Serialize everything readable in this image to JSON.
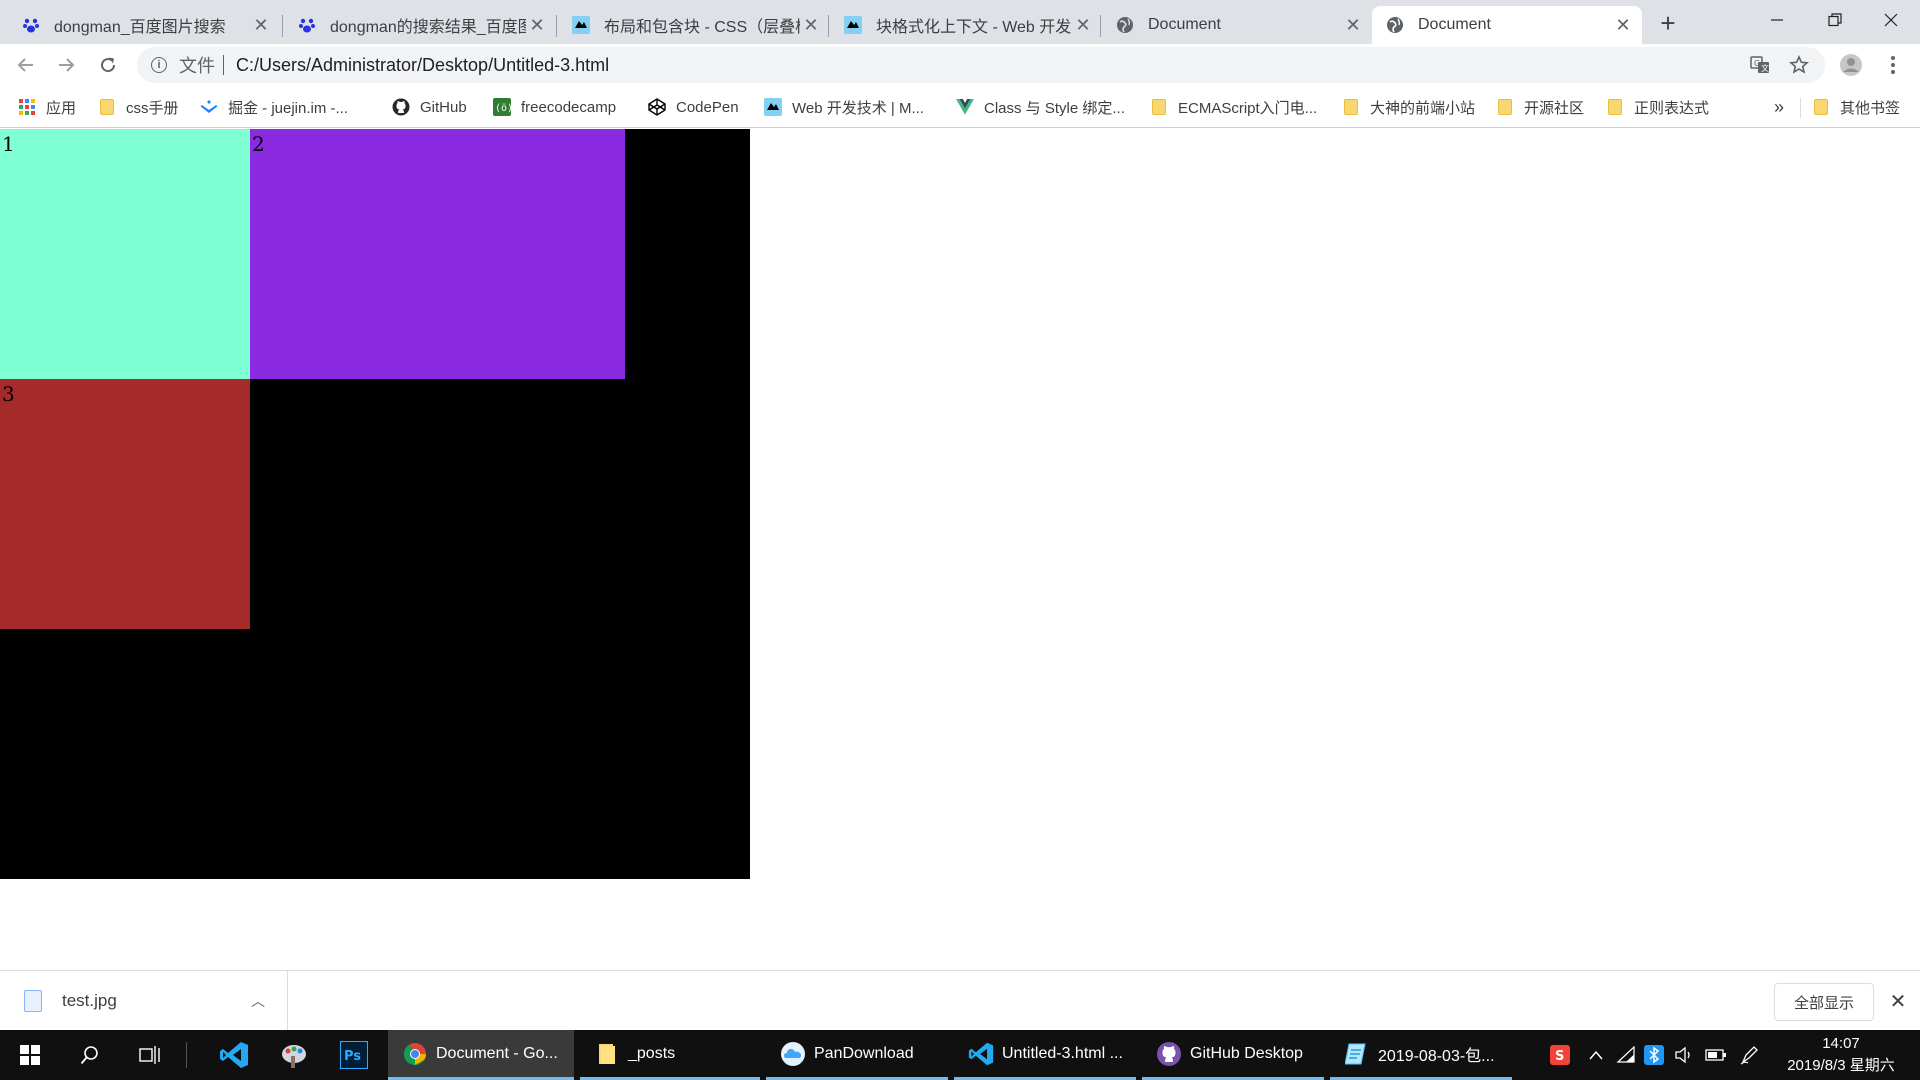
{
  "browser": {
    "tabs": [
      {
        "title": "dongman_百度图片搜索",
        "icon": "baidu-paw-icon"
      },
      {
        "title": "dongman的搜索结果_百度图",
        "icon": "baidu-paw-icon"
      },
      {
        "title": "布局和包含块 - CSS（层叠样",
        "icon": "mdn-icon"
      },
      {
        "title": "块格式化上下文 - Web 开发",
        "icon": "mdn-icon"
      },
      {
        "title": "Document",
        "icon": "globe-icon"
      },
      {
        "title": "Document",
        "icon": "globe-icon",
        "active": true
      }
    ],
    "url_scheme_label": "文件",
    "url": "C:/Users/Administrator/Desktop/Untitled-3.html"
  },
  "bookmarks": [
    {
      "label": "应用",
      "icon": "apps-grid-icon"
    },
    {
      "label": "css手册",
      "icon": "folder-icon"
    },
    {
      "label": "掘金 - juejin.im -...",
      "icon": "juejin-icon"
    },
    {
      "label": "GitHub",
      "icon": "github-icon"
    },
    {
      "label": "freecodecamp",
      "icon": "freecodecamp-icon"
    },
    {
      "label": "CodePen",
      "icon": "codepen-icon"
    },
    {
      "label": "Web 开发技术 | M...",
      "icon": "mdn-icon"
    },
    {
      "label": "Class 与 Style 绑定...",
      "icon": "vue-icon"
    },
    {
      "label": "ECMAScript入门电...",
      "icon": "folder-icon"
    },
    {
      "label": "大神的前端小站",
      "icon": "folder-icon"
    },
    {
      "label": "开源社区",
      "icon": "folder-icon"
    },
    {
      "label": "正则表达式",
      "icon": "folder-icon"
    },
    {
      "label": "其他书签",
      "icon": "folder-icon"
    }
  ],
  "bookmarks_overflow": "»",
  "page": {
    "container_color": "#000000",
    "cells": [
      {
        "label": "1",
        "color": "#7fffd4"
      },
      {
        "label": "2",
        "color": "#8a2be2"
      },
      {
        "label": "3",
        "color": "#a52a2a"
      }
    ]
  },
  "download_shelf": {
    "file_name": "test.jpg",
    "show_all_label": "全部显示"
  },
  "taskbar": {
    "apps": [
      {
        "label": "Document - Go...",
        "icon": "chrome-icon",
        "active": true
      },
      {
        "label": "_posts",
        "icon": "folder-icon"
      },
      {
        "label": "PanDownload",
        "icon": "pandownload-icon"
      },
      {
        "label": "Untitled-3.html ...",
        "icon": "vscode-icon"
      },
      {
        "label": "GitHub Desktop",
        "icon": "github-desktop-icon"
      },
      {
        "label": "2019-08-03-包...",
        "icon": "typora-icon"
      }
    ],
    "clock_time": "14:07",
    "clock_date": "2019/8/3 星期六"
  }
}
